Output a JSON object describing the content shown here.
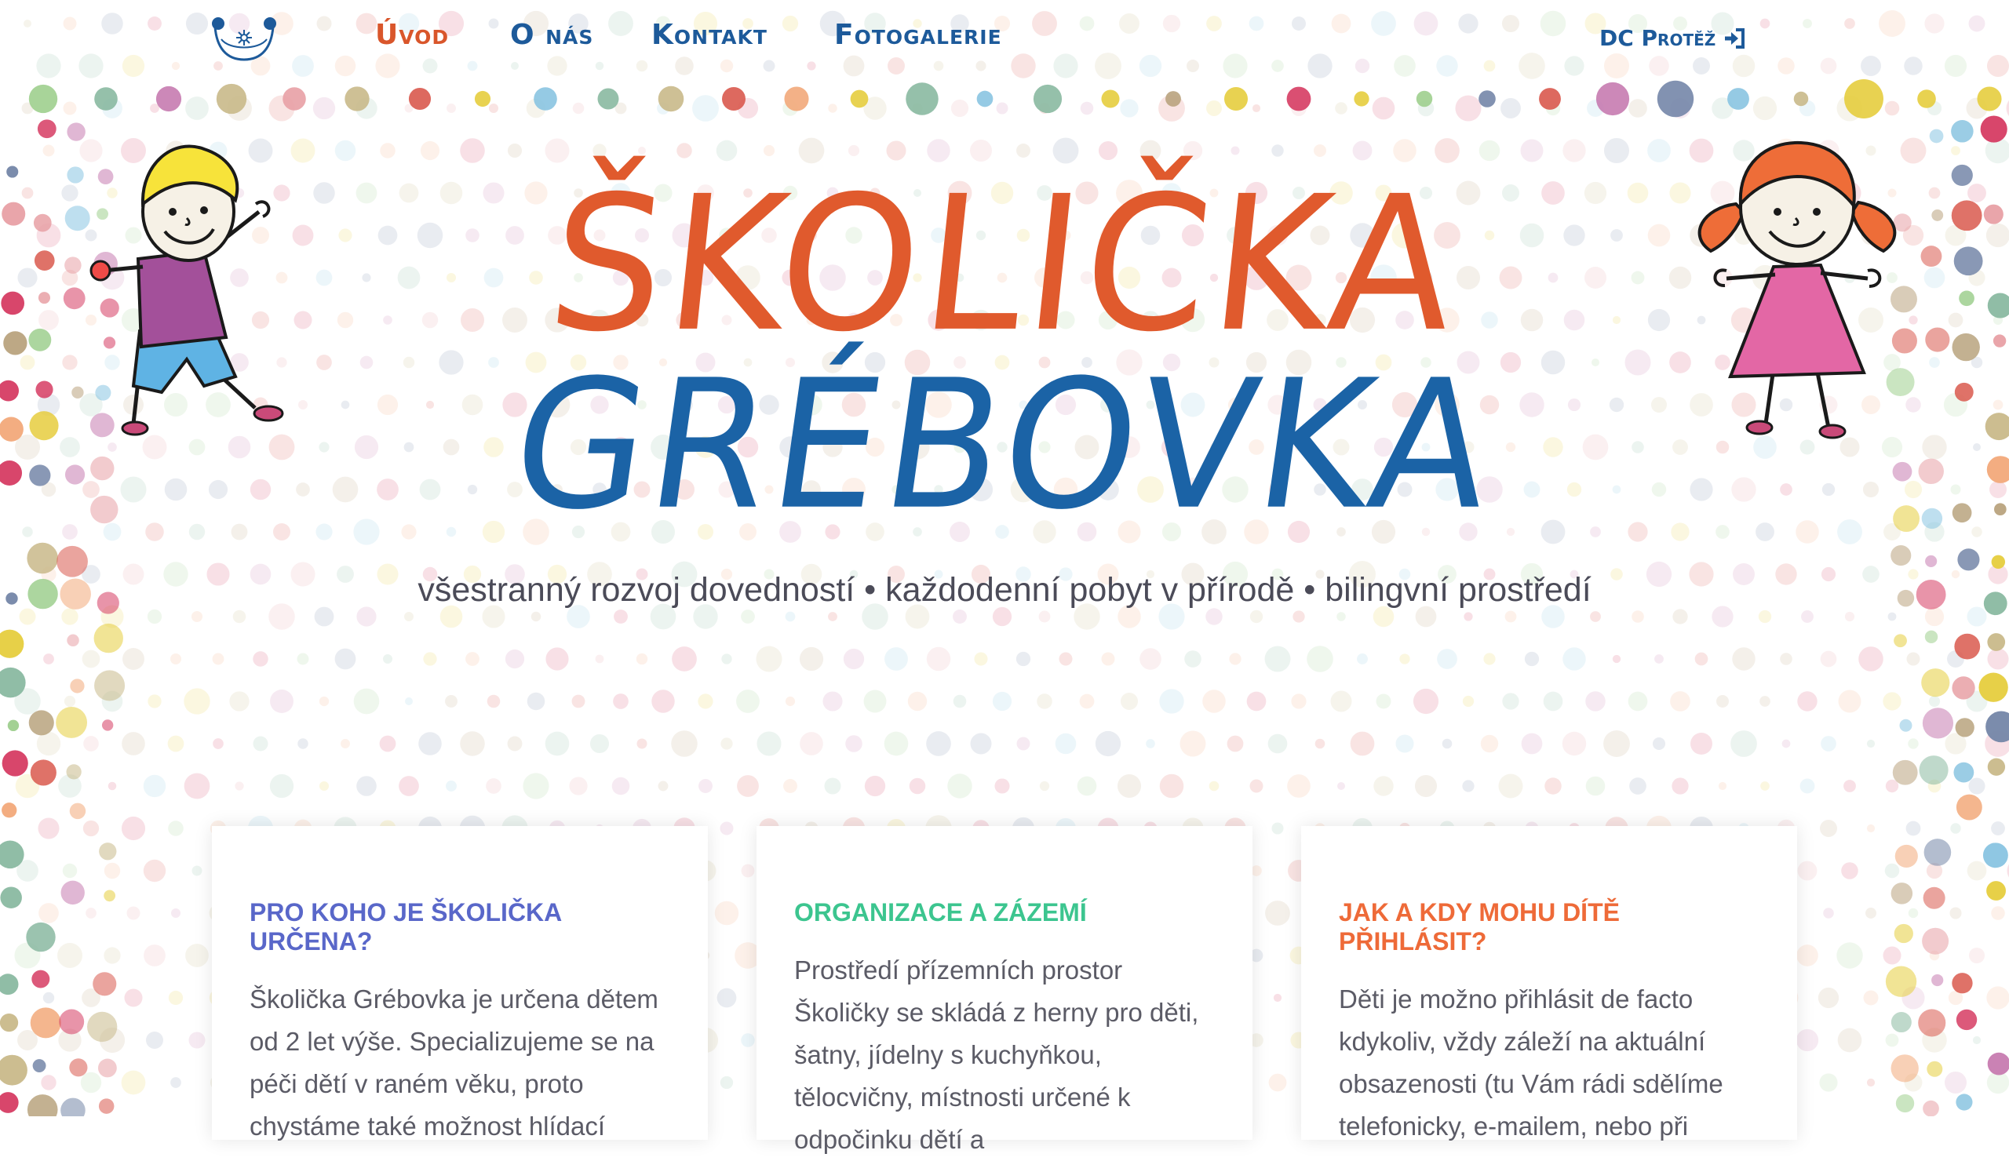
{
  "nav": {
    "logo_icon": "school-logo-icon",
    "links": [
      {
        "label": "Úvod",
        "active": true
      },
      {
        "label": "O nás",
        "active": false
      },
      {
        "label": "Kontakt",
        "active": false
      },
      {
        "label": "Fotogalerie",
        "active": false
      }
    ],
    "login_label": "DC Protěž",
    "login_icon": "sign-in-icon"
  },
  "hero": {
    "title_line1": "Školička",
    "title_line2": "Grébovka",
    "tagline": "všestranný rozvoj dovedností • každodenní pobyt v přírodě • bilingvní prostředí"
  },
  "cards": [
    {
      "heading": "Pro koho je Školička určena?",
      "heading_color": "#5967c9",
      "text": "Školička Grébovka je určena dětem od 2 let výše. Specializujeme se na péči dětí v raném věku, proto chystáme také možnost hlídací"
    },
    {
      "heading": "Organizace a zázemí",
      "heading_color": "#3cc58f",
      "text": "Prostředí přízemních prostor Školičky se skládá z herny pro děti, šatny, jídelny s kuchyňkou, tělocvičny, místnosti určené k odpočinku dětí a"
    },
    {
      "heading": "Jak a kdy mohu dítě přihlásit?",
      "heading_color": "#ee6a38",
      "text": "Děti je možno přihlásit de facto kdykoliv, vždy záleží na aktuální obsazenosti (tu Vám rádi sdělíme telefonicky, e-mailem, nebo při"
    }
  ],
  "colors": {
    "nav_blue": "#1d5a9a",
    "nav_active": "#d9562b",
    "title_orange": "#e05a2d",
    "title_blue": "#1b63a6",
    "dot_palette": [
      "#d9594e",
      "#e8a0a5",
      "#f2a97a",
      "#e6cd3e",
      "#9ecf8e",
      "#89c4e1",
      "#7486a8",
      "#c77bb0",
      "#b9a37e",
      "#d63c63",
      "#8ab9a1",
      "#c9b98a"
    ]
  }
}
